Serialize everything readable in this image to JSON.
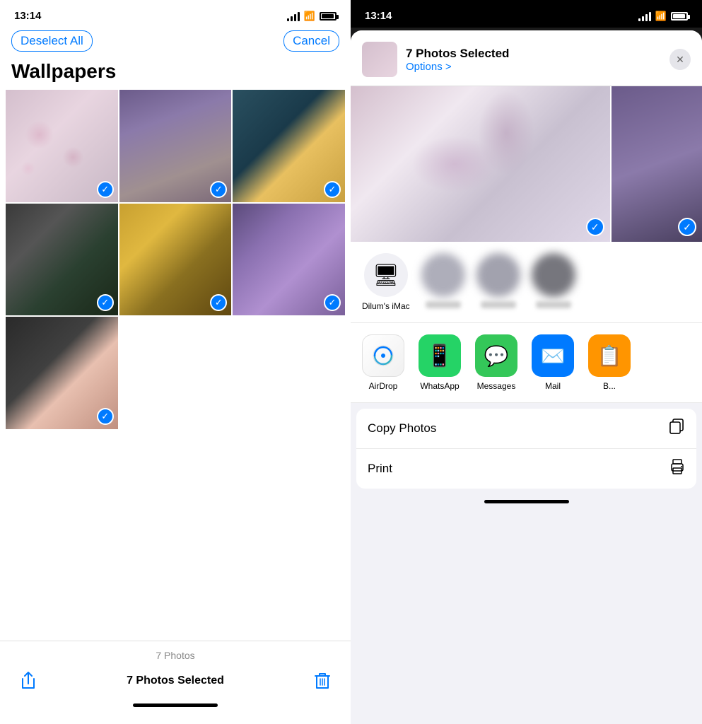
{
  "left": {
    "status_time": "13:14",
    "deselect_all": "Deselect All",
    "cancel": "Cancel",
    "title": "Wallpapers",
    "photos_count": "7 Photos",
    "selected_label": "7 Photos Selected",
    "photos": [
      {
        "id": 1,
        "class": "photo-1",
        "checked": true
      },
      {
        "id": 2,
        "class": "photo-2",
        "checked": true
      },
      {
        "id": 3,
        "class": "photo-3",
        "checked": true
      },
      {
        "id": 4,
        "class": "photo-4",
        "checked": true
      },
      {
        "id": 5,
        "class": "photo-5",
        "checked": true
      },
      {
        "id": 6,
        "class": "photo-6",
        "checked": true
      },
      {
        "id": 7,
        "class": "photo-7",
        "checked": true
      }
    ]
  },
  "right": {
    "status_time": "13:14",
    "share_title": "7 Photos Selected",
    "share_options": "Options >",
    "close_label": "×",
    "device_label": "Dilum's iMac",
    "apps": [
      {
        "id": "airdrop",
        "label": "AirDrop",
        "class": "app-airdrop"
      },
      {
        "id": "whatsapp",
        "label": "WhatsApp",
        "class": "app-whatsapp"
      },
      {
        "id": "messages",
        "label": "Messages",
        "class": "app-messages"
      },
      {
        "id": "mail",
        "label": "Mail",
        "class": "app-mail"
      }
    ],
    "actions": [
      {
        "id": "copy-photos",
        "label": "Copy Photos",
        "icon": "⧉"
      },
      {
        "id": "print",
        "label": "Print",
        "icon": "🖨"
      }
    ]
  }
}
